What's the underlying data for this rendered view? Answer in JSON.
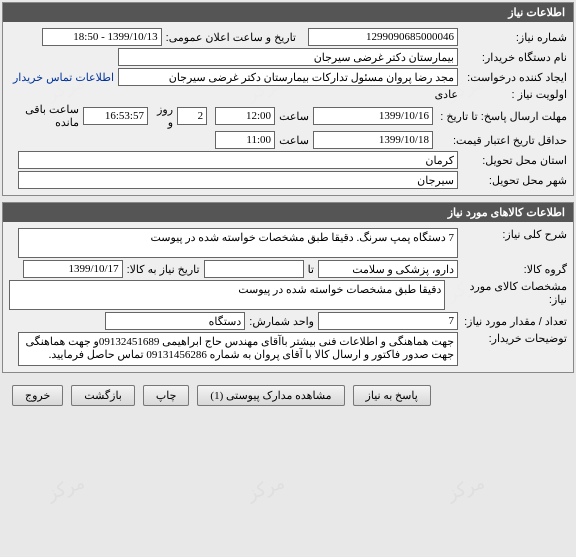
{
  "panel1": {
    "title": "اطلاعات نیاز",
    "req_no_label": "شماره نیاز:",
    "req_no": "1299090685000046",
    "pub_label": "تاریخ و ساعت اعلان عمومی:",
    "pub_value": "1399/10/13 - 18:50",
    "buyer_label": "نام دستگاه خریدار:",
    "buyer_value": "بیمارستان دکتر غرضی سیرجان",
    "creator_label": "ایجاد کننده درخواست:",
    "creator_value": "مجد رضا پروان مسئول تدارکات بیمارستان دکتر غرضی سیرجان",
    "contact_link": "اطلاعات تماس خریدار",
    "priority_label": "اولویت نیاز :",
    "priority_value": "عادی",
    "deadline_label": "مهلت ارسال پاسخ:  تا تاریخ :",
    "deadline_date": "1399/10/16",
    "time_label": "ساعت",
    "deadline_time": "12:00",
    "days_value": "2",
    "days_label": "روز و",
    "remain_time": "16:53:57",
    "remain_label": "ساعت باقی مانده",
    "min_valid_label": "حداقل تاریخ اعتبار قیمت:",
    "min_valid_date": "1399/10/18",
    "min_valid_time": "11:00",
    "province_label": "استان محل تحویل:",
    "province_value": "کرمان",
    "city_label": "شهر محل تحویل:",
    "city_value": "سیرجان"
  },
  "panel2": {
    "title": "اطلاعات کالاهای مورد نیاز",
    "desc_label": "شرح کلی نیاز:",
    "desc_value": "7 دستگاه پمپ سرنگ. دقیقا طبق مشخصات خواسته شده در پیوست",
    "group_label": "گروه کالا:",
    "group_value": "دارو، پزشکی و سلامت",
    "to_label": "تا",
    "need_date_label": "تاریخ نیاز به کالا:",
    "need_date_value": "1399/10/17",
    "spec_label": "مشخصات کالای مورد نیاز:",
    "spec_value": "دقیقا طبق مشخصات خواسته شده در پیوست",
    "qty_label": "تعداد / مقدار مورد نیاز:",
    "qty_value": "7",
    "unit_label": "واحد شمارش:",
    "unit_value": "دستگاه",
    "notes_label": "توضیحات خریدار:",
    "notes_value": "جهت هماهنگی و اطلاعات فنی بیشتر باآقای مهندس حاج ابراهیمی 09132451689و جهت هماهنگی جهت صدور فاکتور و ارسال کالا با آقای پروان به شماره 09131456286 تماس حاصل فرمایید."
  },
  "buttons": {
    "reply": "پاسخ به نیاز",
    "attach": "مشاهده مدارک پیوستی  (1)",
    "print": "چاپ",
    "back": "بازگشت",
    "exit": "خروج"
  }
}
